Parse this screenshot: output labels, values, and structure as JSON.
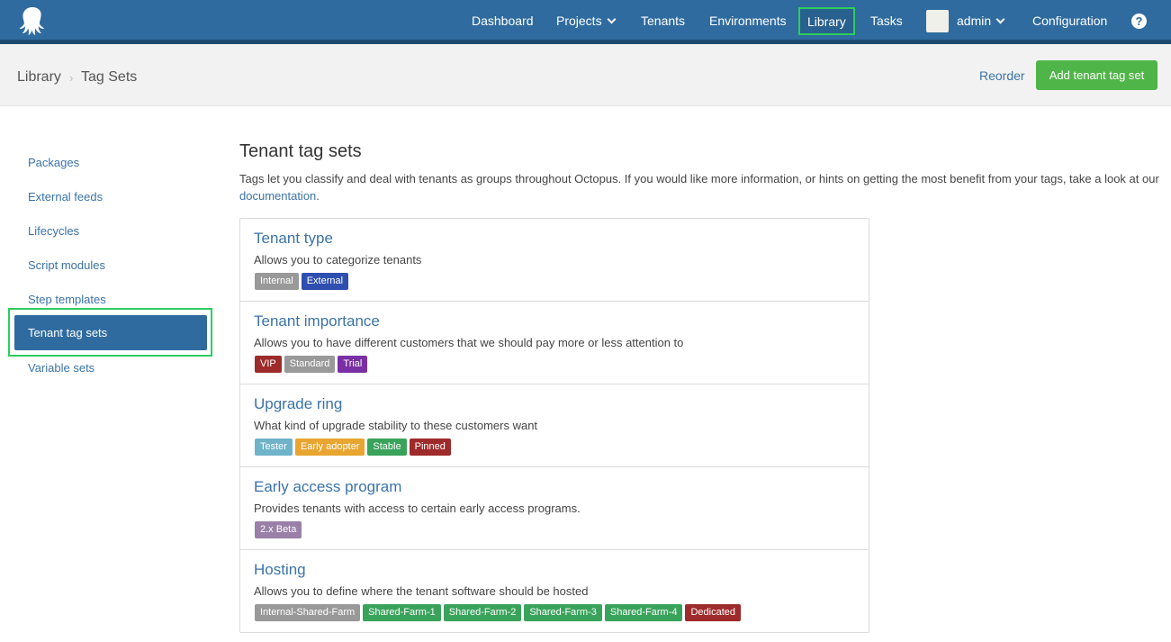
{
  "nav": {
    "items": [
      {
        "label": "Dashboard"
      },
      {
        "label": "Projects"
      },
      {
        "label": "Tenants"
      },
      {
        "label": "Environments"
      },
      {
        "label": "Library"
      },
      {
        "label": "Tasks"
      },
      {
        "label": "admin"
      },
      {
        "label": "Configuration"
      }
    ],
    "help_label": "?",
    "colors": {
      "bar": "#2f6b9f",
      "highlight": "#2ecc5e"
    }
  },
  "breadcrumb": {
    "root": "Library",
    "sep": "›",
    "current": "Tag Sets"
  },
  "actions": {
    "reorder": "Reorder",
    "add": "Add tenant tag set"
  },
  "sidebar": {
    "items": [
      {
        "label": "Packages"
      },
      {
        "label": "External feeds"
      },
      {
        "label": "Lifecycles"
      },
      {
        "label": "Script modules"
      },
      {
        "label": "Step templates"
      },
      {
        "label": "Tenant tag sets",
        "active": true
      },
      {
        "label": "Variable sets"
      }
    ]
  },
  "main": {
    "title": "Tenant tag sets",
    "desc": "Tags let you classify and deal with tenants as groups throughout Octopus. If you would like more information, or hints on getting the most benefit from your tags, take a look at our ",
    "doc_link": "documentation",
    "desc_end": "."
  },
  "tagsets": [
    {
      "title": "Tenant type",
      "desc": "Allows you to categorize tenants",
      "tags": [
        {
          "label": "Internal",
          "color": "#999999"
        },
        {
          "label": "External",
          "color": "#2f4fb0"
        }
      ]
    },
    {
      "title": "Tenant importance",
      "desc": "Allows you to have different customers that we should pay more or less attention to",
      "tags": [
        {
          "label": "VIP",
          "color": "#9e2b2b"
        },
        {
          "label": "Standard",
          "color": "#999999"
        },
        {
          "label": "Trial",
          "color": "#7a2fa5"
        }
      ]
    },
    {
      "title": "Upgrade ring",
      "desc": "What kind of upgrade stability to these customers want",
      "tags": [
        {
          "label": "Tester",
          "color": "#6fb3c9"
        },
        {
          "label": "Early adopter",
          "color": "#e8a530"
        },
        {
          "label": "Stable",
          "color": "#3aa35b"
        },
        {
          "label": "Pinned",
          "color": "#9e2b2b"
        }
      ]
    },
    {
      "title": "Early access program",
      "desc": "Provides tenants with access to certain early access programs.",
      "tags": [
        {
          "label": "2.x Beta",
          "color": "#9a7fa8"
        }
      ]
    },
    {
      "title": "Hosting",
      "desc": "Allows you to define where the tenant software should be hosted",
      "tags": [
        {
          "label": "Internal-Shared-Farm",
          "color": "#999999"
        },
        {
          "label": "Shared-Farm-1",
          "color": "#3aa35b"
        },
        {
          "label": "Shared-Farm-2",
          "color": "#3aa35b"
        },
        {
          "label": "Shared-Farm-3",
          "color": "#3aa35b"
        },
        {
          "label": "Shared-Farm-4",
          "color": "#3aa35b"
        },
        {
          "label": "Dedicated",
          "color": "#9e2b2b"
        }
      ]
    }
  ]
}
